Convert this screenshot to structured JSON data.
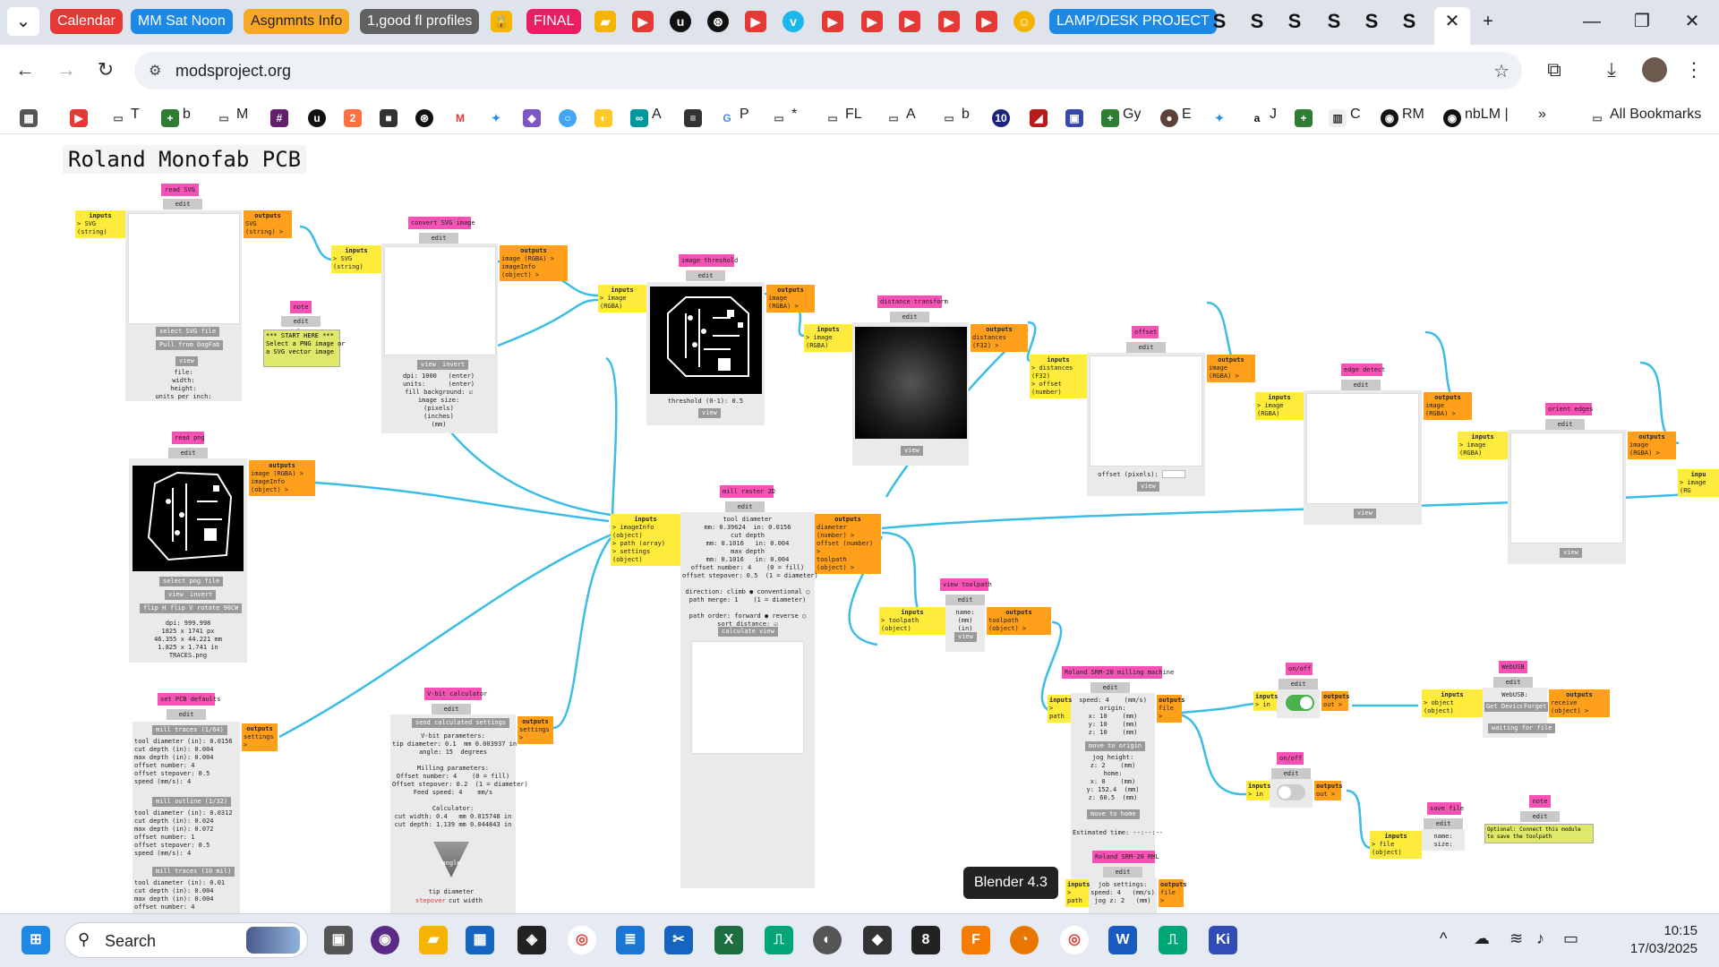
{
  "tabs": [
    {
      "label": "Calendar",
      "color": "#e53935"
    },
    {
      "label": "MM Sat Noon",
      "color": "#1e88e5"
    },
    {
      "label": "Asgnmnts Info",
      "color": "#f9a825"
    },
    {
      "label": "1,good fl profiles",
      "color": "#616161"
    },
    {
      "label": "FINAL",
      "color": "#e91e63"
    },
    {
      "label": "LAMP/DESK PROJECT",
      "color": "#1e88e5"
    }
  ],
  "tab_icons": [
    "lock-icon",
    "folder-icon",
    "youtube-icon",
    "upwork-icon",
    "chatgpt-icon",
    "youtube-icon",
    "vimeo-icon",
    "youtube-icon",
    "youtube-icon",
    "youtube-icon",
    "youtube-icon",
    "youtube-icon",
    "emoji-icon"
  ],
  "s_tabs": [
    "S",
    "S",
    "S",
    "S",
    "S",
    "S"
  ],
  "url": "modsproject.org",
  "bookmarks": [
    {
      "label": "T",
      "icon": "folder"
    },
    {
      "label": "b",
      "icon": "plus"
    },
    {
      "label": "M",
      "icon": "folder"
    },
    {
      "label": "A",
      "icon": "app"
    },
    {
      "label": "P",
      "icon": "google"
    },
    {
      "label": "*",
      "icon": "folder"
    },
    {
      "label": "FL",
      "icon": "folder"
    },
    {
      "label": "A",
      "icon": "folder"
    },
    {
      "label": "b",
      "icon": "folder"
    },
    {
      "label": "Gy",
      "icon": "plus"
    },
    {
      "label": "E",
      "icon": "app"
    },
    {
      "label": "J",
      "icon": "amazon"
    },
    {
      "label": "C",
      "icon": "app"
    },
    {
      "label": "RM",
      "icon": "app"
    },
    {
      "label": "nbLM |",
      "icon": "app"
    }
  ],
  "all_bookmarks": "All Bookmarks",
  "page_title": "Roland Monofab PCB",
  "modules": {
    "read_svg": {
      "title": "read SVG",
      "edit": "edit delete",
      "inputs": "inputs",
      "in1": "SVG (string)",
      "outputs": "outputs",
      "out1": "SVG (string)",
      "btn1": "select SVG file",
      "btn2": "Pull from DogFab",
      "btn3": "view",
      "info": "file:\nwidth:\nheight:\nunits per inch:"
    },
    "note1": {
      "title": "note",
      "edit": "edit delete",
      "text": "*** START HERE ***\nSelect a PNG image or\na SVG vector image"
    },
    "convert_svg": {
      "title": "convert SVG image",
      "edit": "edit delete",
      "inputs": "inputs",
      "in1": "SVG (string)",
      "outputs": "outputs",
      "out1": "image (RGBA)",
      "out2": "imageInfo (object)",
      "btn1": "view",
      "btn2": "invert",
      "info": "dpi: 1000   (enter)\nunits:      (enter)\nfill background: ☑\nimage size:\n(pixels)\n(inches)\n(mm)"
    },
    "image_threshold": {
      "title": "image threshold",
      "edit": "edit delete",
      "inputs": "inputs",
      "in1": "image (RGBA)",
      "outputs": "outputs",
      "out1": "image (RGBA)",
      "info": "threshold (0-1): 0.5",
      "btn1": "view"
    },
    "distance_transform": {
      "title": "distance transform",
      "edit": "edit delete",
      "inputs": "inputs",
      "in1": "image (RGBA)",
      "outputs": "outputs",
      "out1": "distances (F32)",
      "btn1": "view"
    },
    "offset": {
      "title": "offset",
      "edit": "edit delete",
      "inputs": "inputs",
      "in1": "distances (F32)",
      "in2": "offset (number)",
      "outputs": "outputs",
      "out1": "image (RGBA)",
      "info": "offset (pixels):",
      "btn1": "view"
    },
    "edge_detect": {
      "title": "edge detect",
      "edit": "edit delete",
      "inputs": "inputs",
      "in1": "image (RGBA)",
      "outputs": "outputs",
      "out1": "image (RGBA)",
      "btn1": "view"
    },
    "orient_edges": {
      "title": "orient edges",
      "edit": "edit delete",
      "inputs": "inputs",
      "in1": "image (RGBA)",
      "outputs": "outputs",
      "out1": "image (RGBA)",
      "in_next": "inpu",
      "in_next2": "image (RG",
      "btn1": "view"
    },
    "read_png": {
      "title": "read png",
      "edit": "edit delete",
      "outputs": "outputs",
      "out1": "image (RGBA)",
      "out2": "imageInfo (object)",
      "btn1": "select png file",
      "btn2": "view",
      "btn3": "invert",
      "btn4": "flip H",
      "btn5": "flip V",
      "btn6": "rotate 90CW",
      "info": "dpi: 999.998\n1825 x 1741 px\n46.355 x 44.221 mm\n1.825 x 1.741 in\nTRACES.png"
    },
    "mill_raster": {
      "title": "mill raster 2D",
      "edit": "edit delete",
      "inputs": "inputs",
      "in1": "imageInfo (object)",
      "in2": "path (array)",
      "in3": "settings (object)",
      "outputs": "outputs",
      "out1": "diameter (number)",
      "out2": "offset (number)",
      "out3": "toolpath (object)",
      "info": "tool diameter\nmm: 0.39624  in: 0.0156\ncut depth\nmm: 0.1016   in: 0.004\nmax depth\nmm: 0.1016   in: 0.004\noffset number: 4    (0 = fill)\noffset stepover: 0.5  (1 = diameter)\n\ndirection: climb ● conventional ○\npath merge: 1    (1 = diameter)\n\npath order: forward ● reverse ○\nsort distance: ☑",
      "btn1": "calculate",
      "btn2": "view"
    },
    "view_toolpath": {
      "title": "view toolpath",
      "edit": "edit delete",
      "inputs": "inputs",
      "in1": "toolpath (object)",
      "outputs": "outputs",
      "out1": "toolpath (object)",
      "info": "name:\n(mm)\n(in)",
      "btn1": "view"
    },
    "set_pcb": {
      "title": "set PCB defaults",
      "edit": "edit delete",
      "outputs": "outputs",
      "out1": "settings",
      "b1": "mill traces (1/64)",
      "b2": "mill outline (1/32)",
      "b3": "mill traces (10 mil)",
      "info1": "tool diameter (in): 0.0156\ncut depth (in): 0.004\nmax depth (in): 0.004\noffset number: 4\noffset stepover: 0.5\nspeed (mm/s): 4",
      "info2": "tool diameter (in): 0.0312\ncut depth (in): 0.024\nmax depth (in): 0.072\noffset number: 1\noffset stepover: 0.5\nspeed (mm/s): 4",
      "info3": "tool diameter (in): 0.01\ncut depth (in): 0.004\nmax depth (in): 0.004\noffset number: 4"
    },
    "vbit": {
      "title": "V-bit calculator",
      "edit": "edit delete",
      "outputs": "outputs",
      "out1": "settings",
      "btn1": "send calculated settings",
      "info": "V-bit parameters:\ntip diameter: 0.1  mm 0.003937 in\nangle: 15  degrees\n\nMilling parameters:\nOffset number: 4    (0 = fill)\nOffset stepover: 0.2  (1 = diameter)\nFeed speed: 4    mm/s\n\nCalculator:\ncut width: 0.4   mm 0.015748 in\ncut depth: 1.139 mm 0.044843 in",
      "angle": "angle",
      "tip": "tip diameter",
      "stepover": "stepover",
      "cutwidth": "cut width"
    },
    "roland_srm": {
      "title": "Roland SRM-20 milling machine",
      "edit": "edit delete",
      "inputs": "inputs",
      "in1": "path",
      "outputs": "outputs",
      "out1": "file",
      "info": "speed: 4    (mm/s)\norigin:\nx: 10    (mm)\ny: 10    (mm)\nz: 10    (mm)",
      "btn1": "move to origin",
      "info2": "jog height:\nz: 2    (mm)\nhome:\nx: 0    (mm)\ny: 152.4  (mm)\nz: 60.5  (mm)",
      "btn2": "move to home",
      "est": "Estimated time: --:--:--"
    },
    "onoff1": {
      "title": "on/off",
      "edit": "edit delete",
      "inputs": "inputs",
      "in1": "in",
      "outputs": "outputs",
      "out1": "out"
    },
    "onoff2": {
      "title": "on/off",
      "edit": "edit delete",
      "inputs": "inputs",
      "in1": "in",
      "outputs": "outputs",
      "out1": "out"
    },
    "webusb": {
      "title": "WebUSB",
      "edit": "edit delete",
      "inputs": "inputs",
      "in1": "object (object)",
      "outputs": "outputs",
      "out1": "receive (object)",
      "info": "WebUSB:",
      "btn1": "Get Device",
      "btn2": "Forget",
      "btn3": "waiting for file"
    },
    "save_file": {
      "title": "save file",
      "edit": "edit delete",
      "inputs": "inputs",
      "in1": "file (object)",
      "info": "name:\nsize:"
    },
    "note2": {
      "title": "note",
      "edit": "edit delete",
      "text": "Optional: Connect this module\nto save the toolpath"
    },
    "roland_rml": {
      "title": "Roland SRM-20 RML",
      "edit": "edit delete",
      "inputs": "inputs",
      "in1": "path",
      "outputs": "outputs",
      "out1": "file",
      "info": "job settings:\nspeed: 4   (mm/s)\njog z: 2   (mm)"
    }
  },
  "tooltip": "Blender 4.3",
  "taskbar": {
    "search": "Search",
    "time": "10:15",
    "date": "17/03/2025"
  },
  "colors": {
    "wire": "#3cbde6",
    "title": "#f652b6",
    "input": "#ffeb3b",
    "output": "#ff9f1a"
  }
}
